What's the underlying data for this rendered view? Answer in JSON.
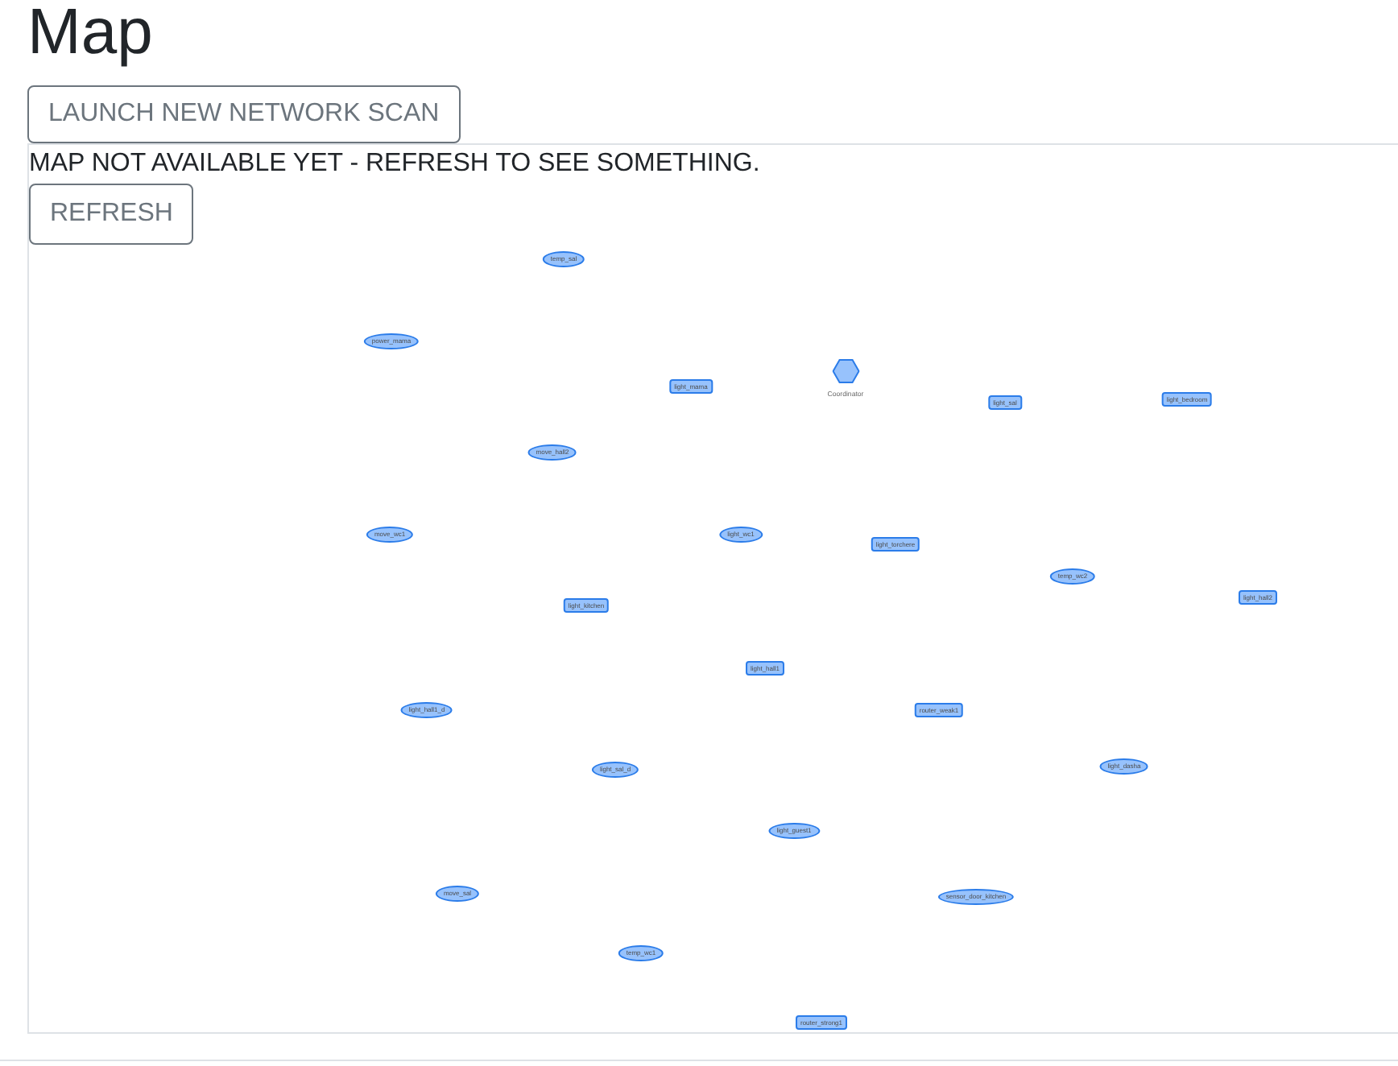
{
  "page": {
    "title": "Map"
  },
  "scan_button": {
    "label": "LAUNCH NEW NETWORK SCAN"
  },
  "map_panel": {
    "message": "MAP NOT AVAILABLE YET - REFRESH TO SEE SOMETHING.",
    "refresh_button": {
      "label": "REFRESH"
    },
    "network_map": {
      "nodes": [
        {
          "label": "temp_sal",
          "kind": "ellipse"
        },
        {
          "label": "power_mama",
          "kind": "ellipse"
        },
        {
          "label": "Coordinator",
          "kind": "hexagon"
        },
        {
          "label": "light_mama",
          "kind": "box"
        },
        {
          "label": "light_bedroom",
          "kind": "box"
        },
        {
          "label": "light_sal",
          "kind": "box"
        },
        {
          "label": "move_hall2",
          "kind": "ellipse"
        },
        {
          "label": "move_wc1",
          "kind": "ellipse"
        },
        {
          "label": "light_wc1",
          "kind": "ellipse"
        },
        {
          "label": "light_torchere",
          "kind": "box"
        },
        {
          "label": "temp_wc2",
          "kind": "ellipse"
        },
        {
          "label": "light_hall2",
          "kind": "box"
        },
        {
          "label": "light_kitchen",
          "kind": "box"
        },
        {
          "label": "light_hall1",
          "kind": "box"
        },
        {
          "label": "router_weak1",
          "kind": "box"
        },
        {
          "label": "light_hall1_d",
          "kind": "ellipse"
        },
        {
          "label": "light_dasha",
          "kind": "ellipse"
        },
        {
          "label": "light_sal_d",
          "kind": "ellipse"
        },
        {
          "label": "light_guest1",
          "kind": "ellipse"
        },
        {
          "label": "move_sal",
          "kind": "ellipse"
        },
        {
          "label": "sensor_door_kitchen",
          "kind": "ellipse"
        },
        {
          "label": "temp_wc1",
          "kind": "ellipse"
        },
        {
          "label": "router_strong1",
          "kind": "box"
        }
      ]
    }
  }
}
